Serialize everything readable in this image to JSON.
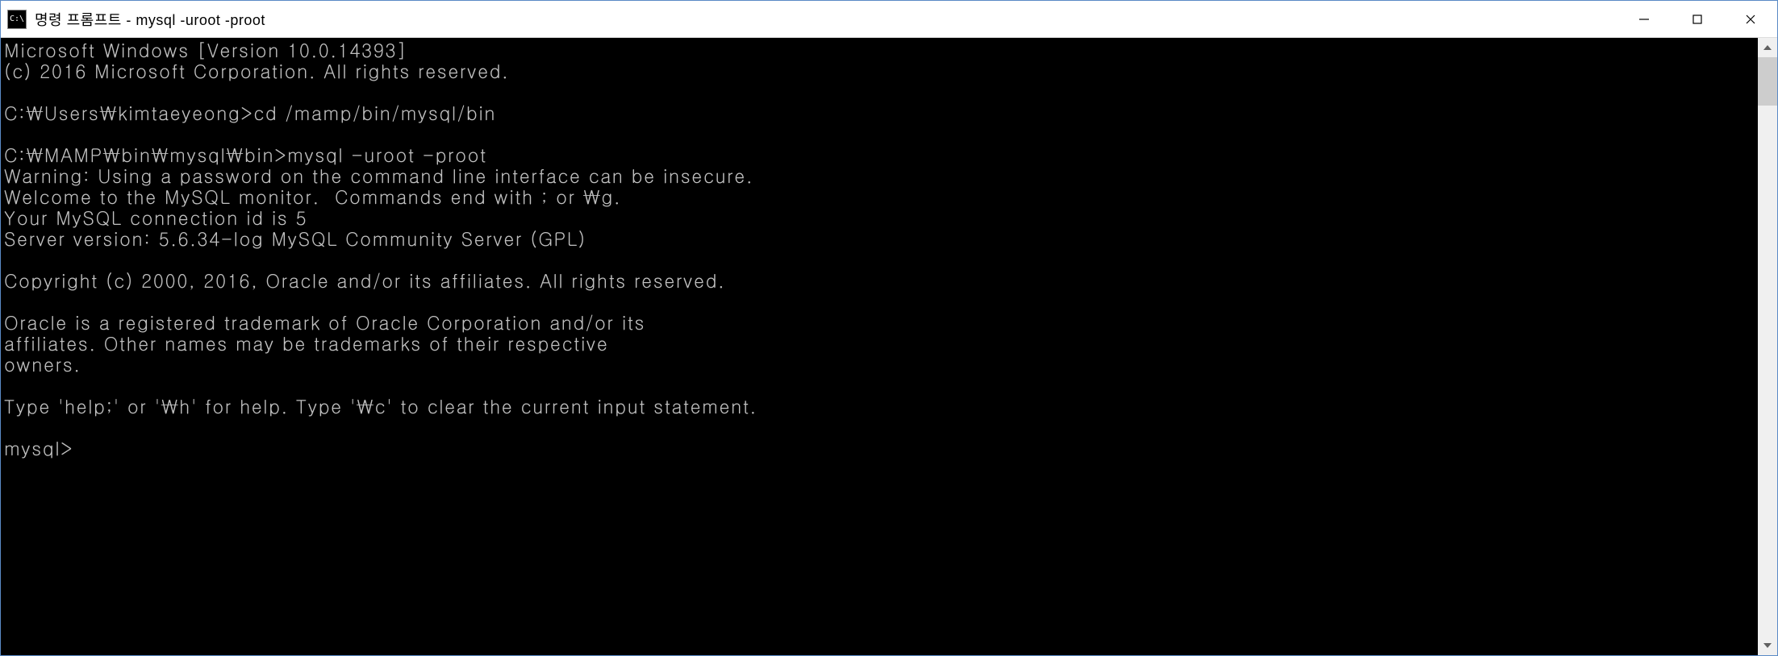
{
  "titlebar": {
    "icon_text": "C:\\",
    "title": "명령 프롬프트 - mysql  -uroot -proot"
  },
  "terminal": {
    "lines": [
      "Microsoft Windows [Version 10.0.14393]",
      "(c) 2016 Microsoft Corporation. All rights reserved.",
      "",
      "C:\\Users\\kimtaeyeong>cd /mamp/bin/mysql/bin",
      "",
      "C:\\MAMP\\bin\\mysql\\bin>mysql -uroot -proot",
      "Warning: Using a password on the command line interface can be insecure.",
      "Welcome to the MySQL monitor.  Commands end with ; or \\g.",
      "Your MySQL connection id is 5",
      "Server version: 5.6.34-log MySQL Community Server (GPL)",
      "",
      "Copyright (c) 2000, 2016, Oracle and/or its affiliates. All rights reserved.",
      "",
      "Oracle is a registered trademark of Oracle Corporation and/or its",
      "affiliates. Other names may be trademarks of their respective",
      "owners.",
      "",
      "Type 'help;' or '\\h' for help. Type '\\c' to clear the current input statement.",
      "",
      "mysql>"
    ]
  }
}
